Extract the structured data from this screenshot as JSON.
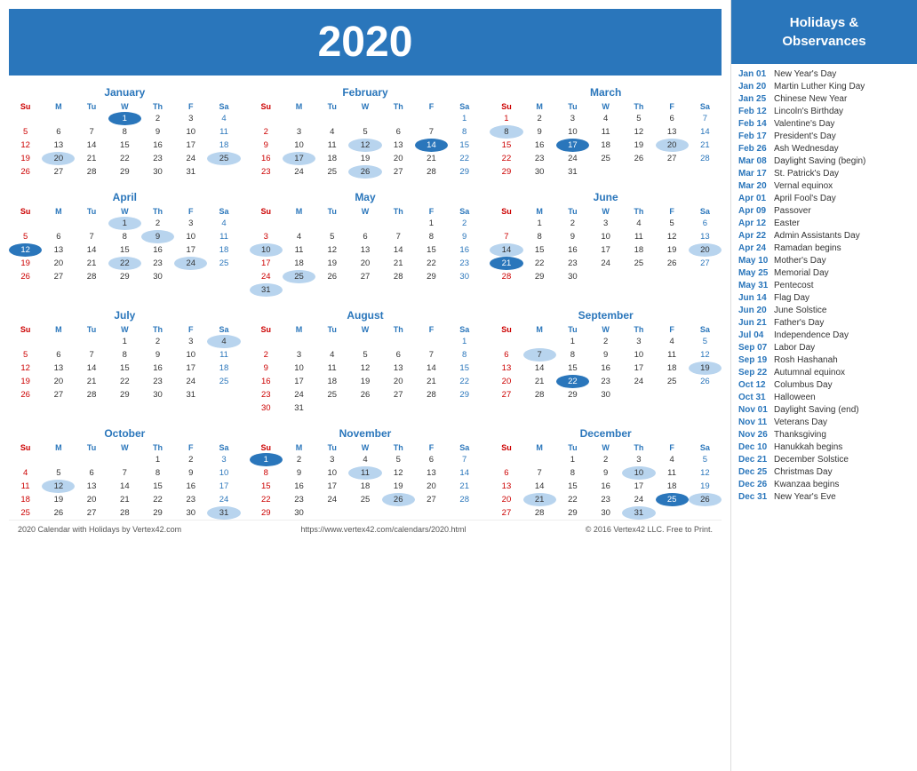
{
  "year": "2020",
  "sidebar": {
    "header": "Holidays &\nObservances",
    "holidays": [
      {
        "date": "Jan 01",
        "name": "New Year's Day"
      },
      {
        "date": "Jan 20",
        "name": "Martin Luther King Day"
      },
      {
        "date": "Jan 25",
        "name": "Chinese New Year"
      },
      {
        "date": "Feb 12",
        "name": "Lincoln's Birthday"
      },
      {
        "date": "Feb 14",
        "name": "Valentine's Day"
      },
      {
        "date": "Feb 17",
        "name": "President's Day"
      },
      {
        "date": "Feb 26",
        "name": "Ash Wednesday"
      },
      {
        "date": "Mar 08",
        "name": "Daylight Saving (begin)"
      },
      {
        "date": "Mar 17",
        "name": "St. Patrick's Day"
      },
      {
        "date": "Mar 20",
        "name": "Vernal equinox"
      },
      {
        "date": "Apr 01",
        "name": "April Fool's Day"
      },
      {
        "date": "Apr 09",
        "name": "Passover"
      },
      {
        "date": "Apr 12",
        "name": "Easter"
      },
      {
        "date": "Apr 22",
        "name": "Admin Assistants Day"
      },
      {
        "date": "Apr 24",
        "name": "Ramadan begins"
      },
      {
        "date": "May 10",
        "name": "Mother's Day"
      },
      {
        "date": "May 25",
        "name": "Memorial Day"
      },
      {
        "date": "May 31",
        "name": "Pentecost"
      },
      {
        "date": "Jun 14",
        "name": "Flag Day"
      },
      {
        "date": "Jun 20",
        "name": "June Solstice"
      },
      {
        "date": "Jun 21",
        "name": "Father's Day"
      },
      {
        "date": "Jul 04",
        "name": "Independence Day"
      },
      {
        "date": "Sep 07",
        "name": "Labor Day"
      },
      {
        "date": "Sep 19",
        "name": "Rosh Hashanah"
      },
      {
        "date": "Sep 22",
        "name": "Autumnal equinox"
      },
      {
        "date": "Oct 12",
        "name": "Columbus Day"
      },
      {
        "date": "Oct 31",
        "name": "Halloween"
      },
      {
        "date": "Nov 01",
        "name": "Daylight Saving (end)"
      },
      {
        "date": "Nov 11",
        "name": "Veterans Day"
      },
      {
        "date": "Nov 26",
        "name": "Thanksgiving"
      },
      {
        "date": "Dec 10",
        "name": "Hanukkah begins"
      },
      {
        "date": "Dec 21",
        "name": "December Solstice"
      },
      {
        "date": "Dec 25",
        "name": "Christmas Day"
      },
      {
        "date": "Dec 26",
        "name": "Kwanzaa begins"
      },
      {
        "date": "Dec 31",
        "name": "New Year's Eve"
      }
    ]
  },
  "months": [
    {
      "name": "January",
      "weeks": [
        [
          null,
          null,
          null,
          "1",
          "2",
          "3",
          "4"
        ],
        [
          "5",
          "6",
          "7",
          "8",
          "9",
          "10",
          "11"
        ],
        [
          "12",
          "13",
          "14",
          "15",
          "16",
          "17",
          "18"
        ],
        [
          "19",
          "20",
          "21",
          "22",
          "23",
          "24",
          "25"
        ],
        [
          "26",
          "27",
          "28",
          "29",
          "30",
          "31",
          null
        ]
      ],
      "highlights": {
        "blue": [
          "1"
        ],
        "light": [
          "20",
          "25"
        ]
      }
    },
    {
      "name": "February",
      "weeks": [
        [
          null,
          null,
          null,
          null,
          null,
          null,
          "1"
        ],
        [
          "2",
          "3",
          "4",
          "5",
          "6",
          "7",
          "8"
        ],
        [
          "9",
          "10",
          "11",
          "12",
          "13",
          "14",
          "15"
        ],
        [
          "16",
          "17",
          "18",
          "19",
          "20",
          "21",
          "22"
        ],
        [
          "23",
          "24",
          "25",
          "26",
          "27",
          "28",
          "29"
        ]
      ],
      "highlights": {
        "blue": [
          "14"
        ],
        "light": [
          "12",
          "17",
          "26"
        ]
      }
    },
    {
      "name": "March",
      "weeks": [
        [
          "1",
          "2",
          "3",
          "4",
          "5",
          "6",
          "7"
        ],
        [
          "8",
          "9",
          "10",
          "11",
          "12",
          "13",
          "14"
        ],
        [
          "15",
          "16",
          "17",
          "18",
          "19",
          "20",
          "21"
        ],
        [
          "22",
          "23",
          "24",
          "25",
          "26",
          "27",
          "28"
        ],
        [
          "29",
          "30",
          "31",
          null,
          null,
          null,
          null
        ]
      ],
      "highlights": {
        "blue": [
          "17"
        ],
        "light": [
          "8",
          "20"
        ]
      }
    },
    {
      "name": "April",
      "weeks": [
        [
          null,
          null,
          null,
          "1",
          "2",
          "3",
          "4"
        ],
        [
          "5",
          "6",
          "7",
          "8",
          "9",
          "10",
          "11"
        ],
        [
          "12",
          "13",
          "14",
          "15",
          "16",
          "17",
          "18"
        ],
        [
          "19",
          "20",
          "21",
          "22",
          "23",
          "24",
          "25"
        ],
        [
          "26",
          "27",
          "28",
          "29",
          "30",
          null,
          null
        ]
      ],
      "highlights": {
        "blue": [
          "12"
        ],
        "light": [
          "1",
          "9",
          "22",
          "24"
        ]
      }
    },
    {
      "name": "May",
      "weeks": [
        [
          null,
          null,
          null,
          null,
          null,
          "1",
          "2"
        ],
        [
          "3",
          "4",
          "5",
          "6",
          "7",
          "8",
          "9"
        ],
        [
          "10",
          "11",
          "12",
          "13",
          "14",
          "15",
          "16"
        ],
        [
          "17",
          "18",
          "19",
          "20",
          "21",
          "22",
          "23"
        ],
        [
          "24",
          "25",
          "26",
          "27",
          "28",
          "29",
          "30"
        ],
        [
          "31",
          null,
          null,
          null,
          null,
          null,
          null
        ]
      ],
      "highlights": {
        "blue": [],
        "light": [
          "10",
          "25",
          "31"
        ]
      }
    },
    {
      "name": "June",
      "weeks": [
        [
          null,
          "1",
          "2",
          "3",
          "4",
          "5",
          "6"
        ],
        [
          "7",
          "8",
          "9",
          "10",
          "11",
          "12",
          "13"
        ],
        [
          "14",
          "15",
          "16",
          "17",
          "18",
          "19",
          "20"
        ],
        [
          "21",
          "22",
          "23",
          "24",
          "25",
          "26",
          "27"
        ],
        [
          "28",
          "29",
          "30",
          null,
          null,
          null,
          null
        ]
      ],
      "highlights": {
        "blue": [
          "21"
        ],
        "light": [
          "14",
          "20"
        ]
      }
    },
    {
      "name": "July",
      "weeks": [
        [
          null,
          null,
          null,
          "1",
          "2",
          "3",
          "4"
        ],
        [
          "5",
          "6",
          "7",
          "8",
          "9",
          "10",
          "11"
        ],
        [
          "12",
          "13",
          "14",
          "15",
          "16",
          "17",
          "18"
        ],
        [
          "19",
          "20",
          "21",
          "22",
          "23",
          "24",
          "25"
        ],
        [
          "26",
          "27",
          "28",
          "29",
          "30",
          "31",
          null
        ]
      ],
      "highlights": {
        "blue": [],
        "light": [
          "4"
        ]
      }
    },
    {
      "name": "August",
      "weeks": [
        [
          null,
          null,
          null,
          null,
          null,
          null,
          "1"
        ],
        [
          "2",
          "3",
          "4",
          "5",
          "6",
          "7",
          "8"
        ],
        [
          "9",
          "10",
          "11",
          "12",
          "13",
          "14",
          "15"
        ],
        [
          "16",
          "17",
          "18",
          "19",
          "20",
          "21",
          "22"
        ],
        [
          "23",
          "24",
          "25",
          "26",
          "27",
          "28",
          "29"
        ],
        [
          "30",
          "31",
          null,
          null,
          null,
          null,
          null
        ]
      ],
      "highlights": {
        "blue": [],
        "light": []
      }
    },
    {
      "name": "September",
      "weeks": [
        [
          null,
          null,
          "1",
          "2",
          "3",
          "4",
          "5"
        ],
        [
          "6",
          "7",
          "8",
          "9",
          "10",
          "11",
          "12"
        ],
        [
          "13",
          "14",
          "15",
          "16",
          "17",
          "18",
          "19"
        ],
        [
          "20",
          "21",
          "22",
          "23",
          "24",
          "25",
          "26"
        ],
        [
          "27",
          "28",
          "29",
          "30",
          null,
          null,
          null
        ]
      ],
      "highlights": {
        "blue": [
          "22"
        ],
        "light": [
          "7",
          "19"
        ]
      }
    },
    {
      "name": "October",
      "weeks": [
        [
          null,
          null,
          null,
          null,
          "1",
          "2",
          "3"
        ],
        [
          "4",
          "5",
          "6",
          "7",
          "8",
          "9",
          "10"
        ],
        [
          "11",
          "12",
          "13",
          "14",
          "15",
          "16",
          "17"
        ],
        [
          "18",
          "19",
          "20",
          "21",
          "22",
          "23",
          "24"
        ],
        [
          "25",
          "26",
          "27",
          "28",
          "29",
          "30",
          "31"
        ]
      ],
      "highlights": {
        "blue": [],
        "light": [
          "12",
          "31"
        ]
      }
    },
    {
      "name": "November",
      "weeks": [
        [
          "1",
          "2",
          "3",
          "4",
          "5",
          "6",
          "7"
        ],
        [
          "8",
          "9",
          "10",
          "11",
          "12",
          "13",
          "14"
        ],
        [
          "15",
          "16",
          "17",
          "18",
          "19",
          "20",
          "21"
        ],
        [
          "22",
          "23",
          "24",
          "25",
          "26",
          "27",
          "28"
        ],
        [
          "29",
          "30",
          null,
          null,
          null,
          null,
          null
        ]
      ],
      "highlights": {
        "blue": [
          "1"
        ],
        "light": [
          "11",
          "26"
        ]
      }
    },
    {
      "name": "December",
      "weeks": [
        [
          null,
          null,
          "1",
          "2",
          "3",
          "4",
          "5"
        ],
        [
          "6",
          "7",
          "8",
          "9",
          "10",
          "11",
          "12"
        ],
        [
          "13",
          "14",
          "15",
          "16",
          "17",
          "18",
          "19"
        ],
        [
          "20",
          "21",
          "22",
          "23",
          "24",
          "25",
          "26"
        ],
        [
          "27",
          "28",
          "29",
          "30",
          "31",
          null,
          null
        ]
      ],
      "highlights": {
        "blue": [
          "25"
        ],
        "light": [
          "10",
          "21",
          "26",
          "31"
        ]
      }
    }
  ],
  "days_header": [
    "Su",
    "M",
    "Tu",
    "W",
    "Th",
    "F",
    "Sa"
  ],
  "footer": {
    "left": "2020 Calendar with Holidays by Vertex42.com",
    "center": "https://www.vertex42.com/calendars/2020.html",
    "right": "© 2016 Vertex42 LLC. Free to Print."
  }
}
